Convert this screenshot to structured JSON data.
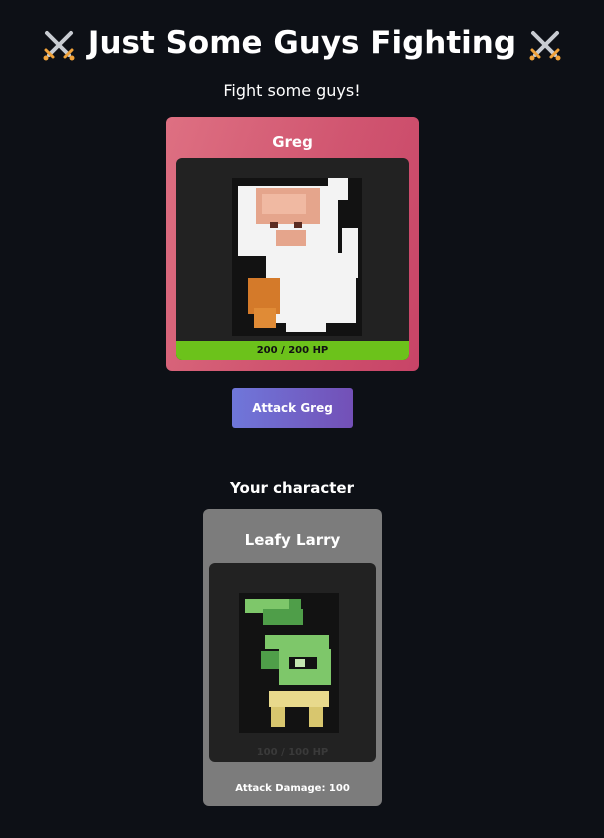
{
  "header": {
    "title": "Just Some Guys Fighting",
    "title_icon": "crossed-swords-icon",
    "subtitle": "Fight some guys!"
  },
  "enemy": {
    "name": "Greg",
    "hp_text": "200 / 200 HP",
    "hp_fraction": 1.0,
    "card_color": "#d05570",
    "hp_color": "#6cc21b"
  },
  "actions": {
    "attack_label": "Attack Greg"
  },
  "player": {
    "section_heading": "Your character",
    "name": "Leafy Larry",
    "hp_text": "100 / 100 HP",
    "attack_damage_text": "Attack Damage: 100",
    "card_color": "#7c7c7c"
  }
}
